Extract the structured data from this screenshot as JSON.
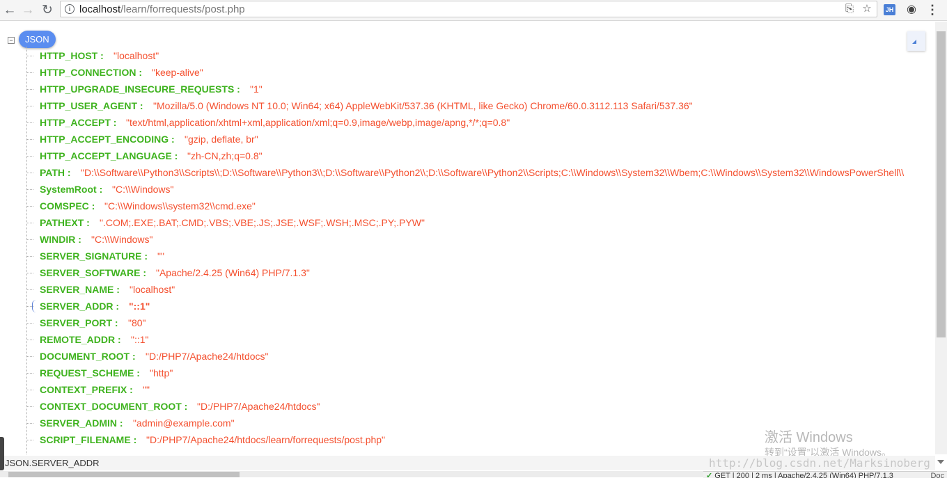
{
  "browser": {
    "url_host": "localhost",
    "url_path": "/learn/forrequests/post.php",
    "icons": {
      "back": "back-arrow-icon",
      "forward": "forward-arrow-icon",
      "reload": "reload-icon",
      "info": "info-icon",
      "translate": "translate-icon",
      "bookmark": "star-icon",
      "extension_jh_label": "JH",
      "extension_eye": "eye-icon",
      "menu": "kebab-menu-icon"
    }
  },
  "viewer": {
    "root_label": "JSON",
    "collapse_symbol": "−",
    "entries": [
      {
        "key": "HTTP_HOST :",
        "value": "\"localhost\""
      },
      {
        "key": "HTTP_CONNECTION :",
        "value": "\"keep-alive\""
      },
      {
        "key": "HTTP_UPGRADE_INSECURE_REQUESTS :",
        "value": "\"1\""
      },
      {
        "key": "HTTP_USER_AGENT :",
        "value": "\"Mozilla/5.0 (Windows NT 10.0; Win64; x64) AppleWebKit/537.36 (KHTML, like Gecko) Chrome/60.0.3112.113 Safari/537.36\""
      },
      {
        "key": "HTTP_ACCEPT :",
        "value": "\"text/html,application/xhtml+xml,application/xml;q=0.9,image/webp,image/apng,*/*;q=0.8\""
      },
      {
        "key": "HTTP_ACCEPT_ENCODING :",
        "value": "\"gzip, deflate, br\""
      },
      {
        "key": "HTTP_ACCEPT_LANGUAGE :",
        "value": "\"zh-CN,zh;q=0.8\""
      },
      {
        "key": "PATH :",
        "value": "\"D:\\\\Software\\\\Python3\\\\Scripts\\\\;D:\\\\Software\\\\Python3\\\\;D:\\\\Software\\\\Python2\\\\;D:\\\\Software\\\\Python2\\\\Scripts;C:\\\\Windows\\\\System32\\\\Wbem;C:\\\\Windows\\\\System32\\\\WindowsPowerShell\\\\"
      },
      {
        "key": "SystemRoot :",
        "value": "\"C:\\\\Windows\""
      },
      {
        "key": "COMSPEC :",
        "value": "\"C:\\\\Windows\\\\system32\\\\cmd.exe\""
      },
      {
        "key": "PATHEXT :",
        "value": "\".COM;.EXE;.BAT;.CMD;.VBS;.VBE;.JS;.JSE;.WSF;.WSH;.MSC;.PY;.PYW\""
      },
      {
        "key": "WINDIR :",
        "value": "\"C:\\\\Windows\""
      },
      {
        "key": "SERVER_SIGNATURE :",
        "value": "\"\""
      },
      {
        "key": "SERVER_SOFTWARE :",
        "value": "\"Apache/2.4.25 (Win64) PHP/7.1.3\""
      },
      {
        "key": "SERVER_NAME :",
        "value": "\"localhost\""
      },
      {
        "key": "SERVER_ADDR :",
        "value": "\"::1\""
      },
      {
        "key": "SERVER_PORT :",
        "value": "\"80\""
      },
      {
        "key": "REMOTE_ADDR :",
        "value": "\"::1\""
      },
      {
        "key": "DOCUMENT_ROOT :",
        "value": "\"D:/PHP7/Apache24/htdocs\""
      },
      {
        "key": "REQUEST_SCHEME :",
        "value": "\"http\""
      },
      {
        "key": "CONTEXT_PREFIX :",
        "value": "\"\""
      },
      {
        "key": "CONTEXT_DOCUMENT_ROOT :",
        "value": "\"D:/PHP7/Apache24/htdocs\""
      },
      {
        "key": "SERVER_ADMIN :",
        "value": "\"admin@example.com\""
      },
      {
        "key": "SCRIPT_FILENAME :",
        "value": "\"D:/PHP7/Apache24/htdocs/learn/forrequests/post.php\""
      }
    ]
  },
  "path_bar": {
    "path": "JSON.SERVER_ADDR"
  },
  "watermark": {
    "title": "激活 Windows",
    "subtitle": "转到“设置”以激活 Windows。",
    "blog": "http://blog.csdn.net/Marksinoberg"
  },
  "status": {
    "check": "✓",
    "text": "GET | 200 | 2 ms | Apache/2.4.25 (Win64) PHP/7.1.3",
    "doc": "Doc"
  },
  "colors": {
    "key": "#3fb31f",
    "value": "#f4502f",
    "badge": "#5a8df0"
  }
}
